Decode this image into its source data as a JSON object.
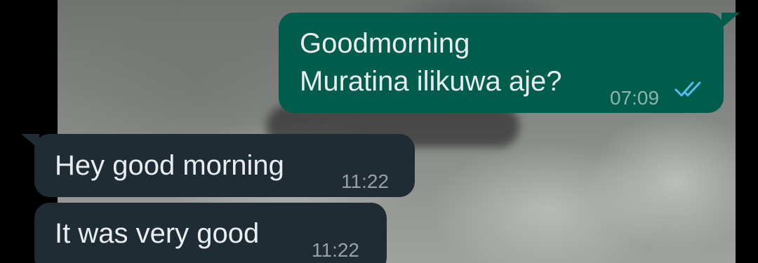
{
  "messages": [
    {
      "direction": "outgoing",
      "line1": "Goodmorning",
      "line2": "Muratina ilikuwa aje?",
      "time": "07:09",
      "status_icon": "double-check-read-icon",
      "status_color": "#53bdeb"
    },
    {
      "direction": "incoming",
      "text": "Hey good morning",
      "time": "11:22"
    },
    {
      "direction": "incoming",
      "text": "It was very good",
      "time": "11:22"
    }
  ],
  "colors": {
    "outgoing_bubble": "#005c4b",
    "incoming_bubble": "#202c33",
    "message_text": "#e9edef",
    "read_ticks": "#53bdeb"
  }
}
